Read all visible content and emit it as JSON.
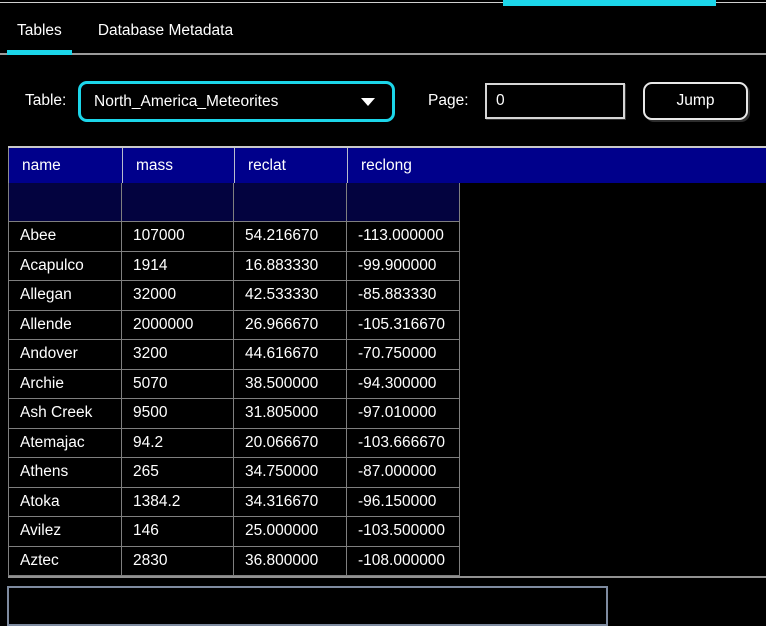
{
  "window": {
    "top_accent_bar": {
      "present": true,
      "color": "#1cd6ea"
    }
  },
  "tabs": {
    "items": [
      {
        "label": "Tables",
        "active": true
      },
      {
        "label": "Database Metadata",
        "active": false
      }
    ]
  },
  "toolbar": {
    "table_label": "Table:",
    "table_dropdown_value": "North_America_Meteorites",
    "page_label": "Page:",
    "page_input_value": "0",
    "jump_button_label": "Jump"
  },
  "grid": {
    "columns": [
      "name",
      "mass",
      "reclat",
      "reclong"
    ],
    "filter_values": [
      "",
      "",
      "",
      ""
    ],
    "rows": [
      [
        "Abee",
        "107000",
        "54.216670",
        "-113.000000"
      ],
      [
        "Acapulco",
        "1914",
        "16.883330",
        "-99.900000"
      ],
      [
        "Allegan",
        "32000",
        "42.533330",
        "-85.883330"
      ],
      [
        "Allende",
        "2000000",
        "26.966670",
        "-105.316670"
      ],
      [
        "Andover",
        "3200",
        "44.616670",
        "-70.750000"
      ],
      [
        "Archie",
        "5070",
        "38.500000",
        "-94.300000"
      ],
      [
        "Ash Creek",
        "9500",
        "31.805000",
        "-97.010000"
      ],
      [
        "Atemajac",
        "94.2",
        "20.066670",
        "-103.666670"
      ],
      [
        "Athens",
        "265",
        "34.750000",
        "-87.000000"
      ],
      [
        "Atoka",
        "1384.2",
        "34.316670",
        "-96.150000"
      ],
      [
        "Avilez",
        "146",
        "25.000000",
        "-103.500000"
      ],
      [
        "Aztec",
        "2830",
        "36.800000",
        "-108.000000"
      ]
    ]
  },
  "bottom_panel": {
    "value": ""
  },
  "colors": {
    "accent_cyan": "#1cd6ea",
    "header_navy": "#00008b",
    "filter_cell_navy": "#03033f",
    "grid_border": "#7f7f7f",
    "background": "#000000",
    "text": "#ffffff"
  }
}
